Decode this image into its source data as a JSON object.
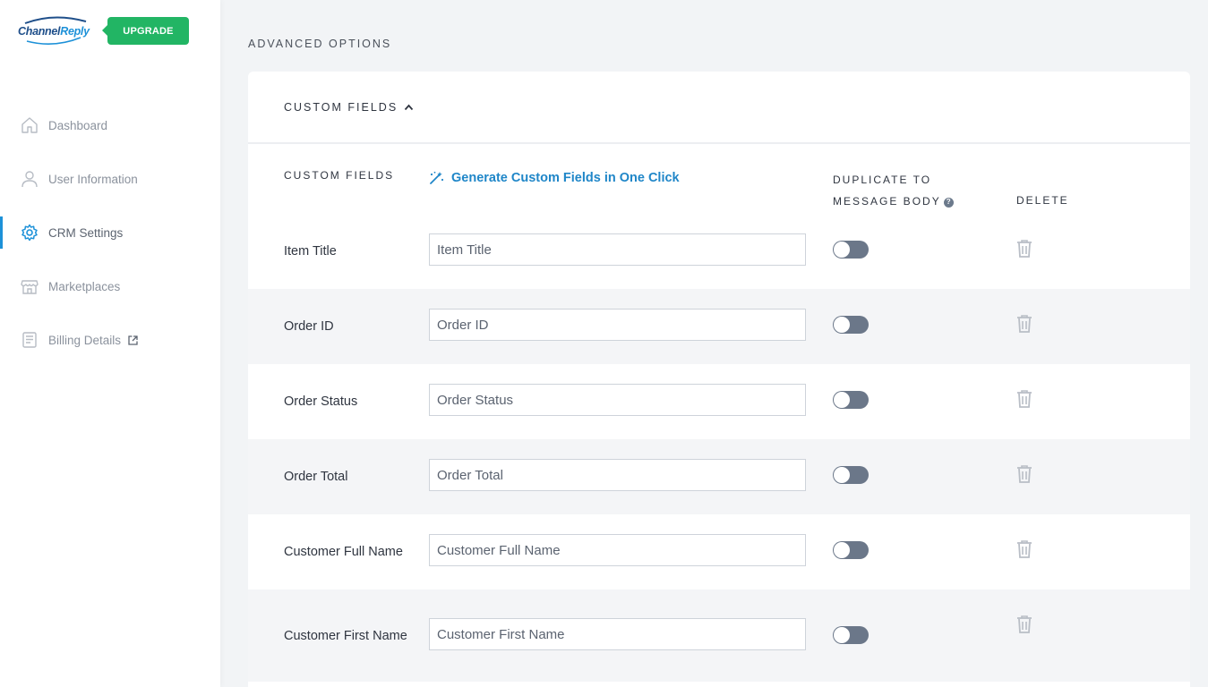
{
  "brand": {
    "logo_part1": "Channel",
    "logo_part2": "Reply",
    "upgrade_label": "UPGRADE",
    "upgrade_color": "#22b564"
  },
  "sidebar": {
    "items": [
      {
        "label": "Dashboard",
        "icon": "home-icon",
        "active": false
      },
      {
        "label": "User Information",
        "icon": "user-icon",
        "active": false
      },
      {
        "label": "CRM Settings",
        "icon": "gear-icon",
        "active": true
      },
      {
        "label": "Marketplaces",
        "icon": "store-icon",
        "active": false
      },
      {
        "label": "Billing Details",
        "icon": "billing-icon",
        "active": false,
        "external": true
      }
    ],
    "active_color": "#1d91d8"
  },
  "main": {
    "section_title": "ADVANCED OPTIONS",
    "card": {
      "header_label": "CUSTOM FIELDS",
      "columns": {
        "fields": "CUSTOM FIELDS",
        "generate_link": "Generate Custom Fields in One Click",
        "duplicate_line1": "DUPLICATE TO",
        "duplicate_line2": "MESSAGE BODY",
        "help": "?",
        "delete": "DELETE"
      },
      "rows": [
        {
          "label": "Item Title",
          "value": "Item Title",
          "duplicate": false
        },
        {
          "label": "Order ID",
          "value": "Order ID",
          "duplicate": false
        },
        {
          "label": "Order Status",
          "value": "Order Status",
          "duplicate": false
        },
        {
          "label": "Order Total",
          "value": "Order Total",
          "duplicate": false
        },
        {
          "label": "Customer Full Name",
          "value": "Customer Full Name",
          "duplicate": false
        },
        {
          "label": "Customer First Name",
          "value": "Customer First Name",
          "duplicate": false
        }
      ]
    }
  }
}
